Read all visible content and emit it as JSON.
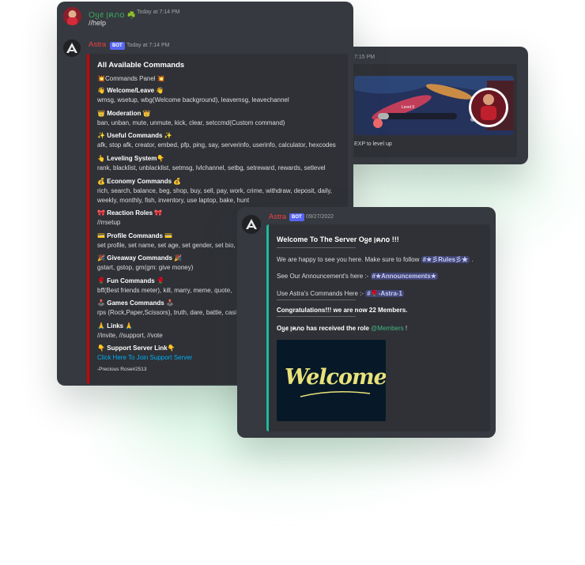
{
  "back_card": {
    "timestamp_partial": "7:15 PM",
    "level_text": "Level 0",
    "footer_partial": "EXP to level up"
  },
  "help_card": {
    "user": {
      "name": "Oყꫀ ןคภ໐",
      "name_emoji": "☘️",
      "timestamp": "Today at 7:14 PM"
    },
    "message": "//help",
    "bot": {
      "name": "Astra",
      "tag": "BOT",
      "timestamp": "Today at 7:14 PM"
    },
    "embed": {
      "title": "All Available Commands",
      "panel": {
        "icon": "💥",
        "label": "Commands Panel"
      },
      "sections": [
        {
          "icon": "👋",
          "heading": "Welcome/Leave",
          "commands": "wmsg, wsetup, wbg(Welcome background), leavemsg, leavechannel"
        },
        {
          "icon": "👑",
          "heading": "Moderation",
          "commands": "ban, unban, mute, unmute, kick, clear, setccmd(Custom command)"
        },
        {
          "icon": "✨",
          "heading": "Useful Commands",
          "commands": "afk, stop afk, creator, embed, pfp, ping, say, serverinfo, userinfo, calculator, hexcodes"
        },
        {
          "icon": "👆",
          "icon2": "👇",
          "heading": "Leveling System",
          "commands": "rank, blacklist, unblacklist, setmsg, lvlchannel, setbg, setreward, rewards, setlevel"
        },
        {
          "icon": "💰",
          "heading": "Economy Commands",
          "commands": "rich, search, balance, beg, shop, buy, sell, pay, work, crime, withdraw, deposit, daily,",
          "commands2": "weekly, monthly, fish, inventory, use laptop, bake, hunt"
        },
        {
          "icon": "🎀",
          "heading": "Reaction Roles",
          "commands": "//rrsetup"
        },
        {
          "icon": "💳",
          "heading": "Profile Commands",
          "commands": "set profile, set name, set age, set gender, set bio,"
        },
        {
          "icon": "🎉",
          "heading": "Giveaway Commands",
          "commands": "gstart, gstop, gm(gm: give money)"
        },
        {
          "icon": "🌹",
          "heading": "Fun Commands",
          "commands": "bff(Best friends meter), kill, marry, meme, quote,"
        },
        {
          "icon": "🕹️",
          "heading": "Games Commands",
          "commands": "rps (Rock,Paper,Scissors), truth, dare, battle, casi"
        },
        {
          "icon": "🙏",
          "heading": "Links",
          "commands": "//invite, //support, //vote"
        },
        {
          "icon": "👇",
          "heading": "Support Server Link",
          "commands": "Click Here To Join Support Server"
        }
      ],
      "footer": "-Precious Rose#2513"
    }
  },
  "welcome_card": {
    "bot": {
      "name": "Astra",
      "tag": "BOT",
      "timestamp": "09/27/2022"
    },
    "embed": {
      "title": "Welcome To The Server Oყꫀ ןคภ໐ !!!",
      "divider": "--------------------------------------------------",
      "follow_text": "We are happy to see you here. Make sure to follow",
      "rules_channel": "#★彡Rules彡★",
      "announce_text": "See Our Announcement's here :-",
      "announce_channel": "#★Announcements★",
      "commands_text": "Use Astra's Commands Here :-",
      "commands_channel": "#🌹-Astra-1",
      "members_text": "Congratulations!!! we are now 22 Members.",
      "role_user": "Oყꫀ ןคภ໐",
      "role_text": "has received the role",
      "role_name": "@Members",
      "role_end": "!",
      "image_text": "Welcome"
    }
  },
  "colors": {
    "green_name": "#3ba55d",
    "red_name": "#ed4245",
    "embed_bar_red": "#d50000",
    "embed_bar_teal": "#1abc9c",
    "link": "#00aff4"
  }
}
